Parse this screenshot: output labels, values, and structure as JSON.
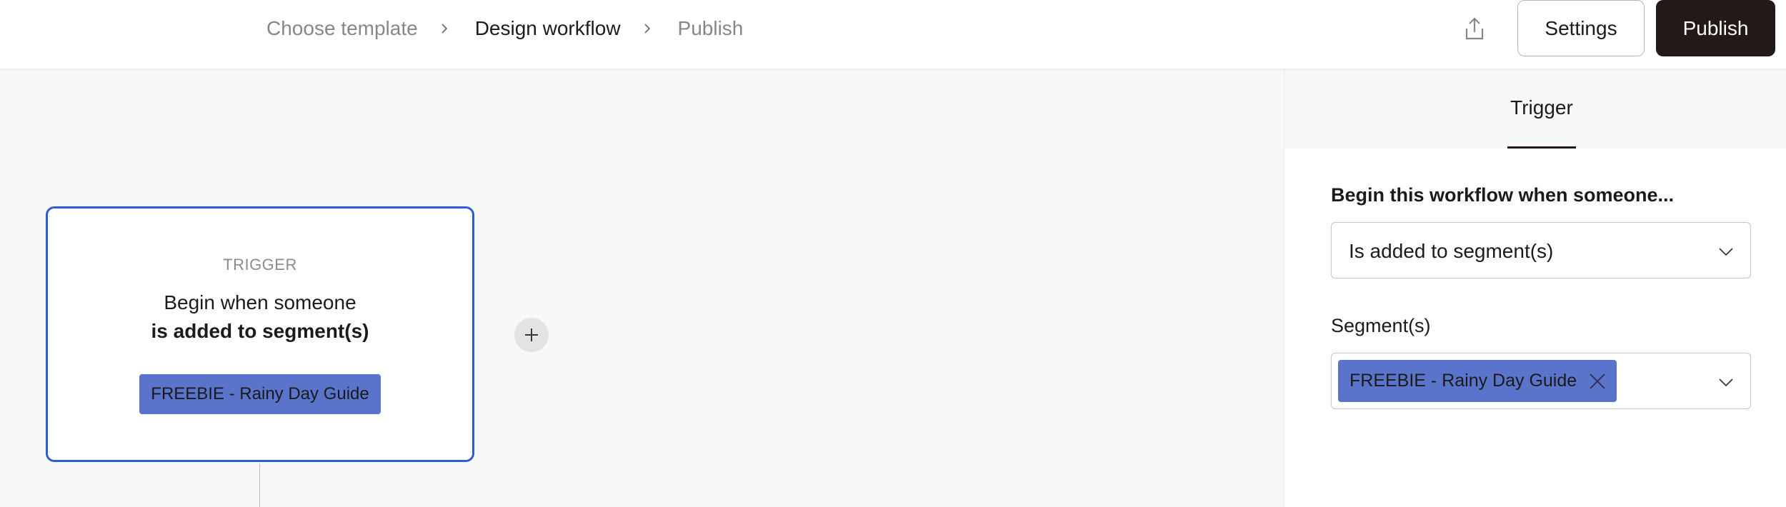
{
  "breadcrumb": {
    "step1": "Choose template",
    "step2": "Design workflow",
    "step3": "Publish"
  },
  "header": {
    "share_icon": "share-icon",
    "settings_label": "Settings",
    "publish_label": "Publish"
  },
  "canvas": {
    "trigger_card": {
      "eyebrow": "TRIGGER",
      "line1": "Begin when someone",
      "line2": "is added to segment(s)",
      "tag": "FREEBIE - Rainy Day Guide"
    },
    "add_step_icon": "plus-icon"
  },
  "panel": {
    "tab_label": "Trigger",
    "begin_label": "Begin this workflow when someone...",
    "event_value": "Is added to segment(s)",
    "segments_label": "Segment(s)",
    "selected_segment": "FREEBIE - Rainy Day Guide"
  },
  "colors": {
    "accent_dark": "#231a18",
    "selection_border": "#2e5bd6",
    "segment_chip": "#5b74cb"
  }
}
